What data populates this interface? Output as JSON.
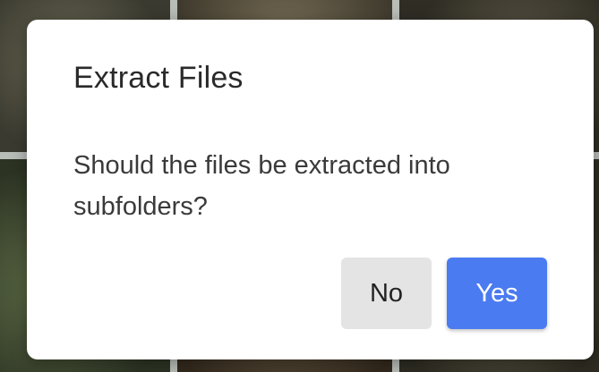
{
  "dialog": {
    "title": "Extract Files",
    "message": "Should the files be extracted into subfolders?",
    "no_label": "No",
    "yes_label": "Yes"
  },
  "colors": {
    "primary_button": "#4b7bf1",
    "secondary_button": "#e4e4e4",
    "dialog_background": "#ffffff"
  }
}
